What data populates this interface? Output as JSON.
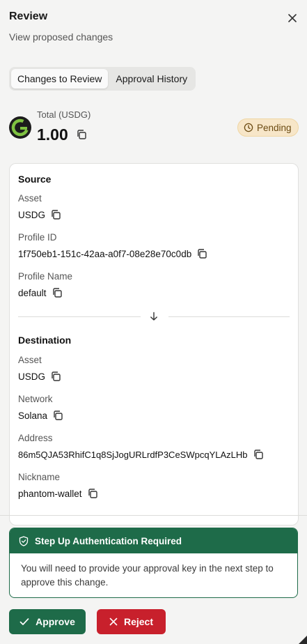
{
  "header": {
    "title": "Review",
    "subtitle": "View proposed changes"
  },
  "tabs": [
    {
      "label": "Changes to Review",
      "active": true
    },
    {
      "label": "Approval History",
      "active": false
    }
  ],
  "total": {
    "label": "Total (USDG)",
    "value": "1.00",
    "status": "Pending"
  },
  "source": {
    "title": "Source",
    "asset_label": "Asset",
    "asset_value": "USDG",
    "profile_id_label": "Profile ID",
    "profile_id_value": "1f750eb1-151c-42aa-a0f7-08e28e70c0db",
    "profile_name_label": "Profile Name",
    "profile_name_value": "default"
  },
  "destination": {
    "title": "Destination",
    "asset_label": "Asset",
    "asset_value": "USDG",
    "network_label": "Network",
    "network_value": "Solana",
    "address_label": "Address",
    "address_value": "86m5QJA53RhifC1q8SjJogURLrdfP3CeSWpcqYLAzLHb",
    "nickname_label": "Nickname",
    "nickname_value": "phantom-wallet"
  },
  "auth": {
    "title": "Step Up Authentication Required",
    "message": "You will need to provide your approval key in the next step to approve this change."
  },
  "actions": {
    "approve_label": "Approve",
    "reject_label": "Reject"
  },
  "colors": {
    "brand_green": "#1e6b49",
    "reject_red": "#c8202c",
    "pending_bg": "#f7e6c8",
    "logo_green": "#7fc241"
  },
  "icons": {
    "close": "close-icon",
    "copy": "copy-icon",
    "clock": "clock-icon",
    "arrow": "arrow-down-icon",
    "shield": "shield-check-icon",
    "check": "check-icon",
    "x": "x-icon",
    "logo": "usdg-logo-icon"
  }
}
